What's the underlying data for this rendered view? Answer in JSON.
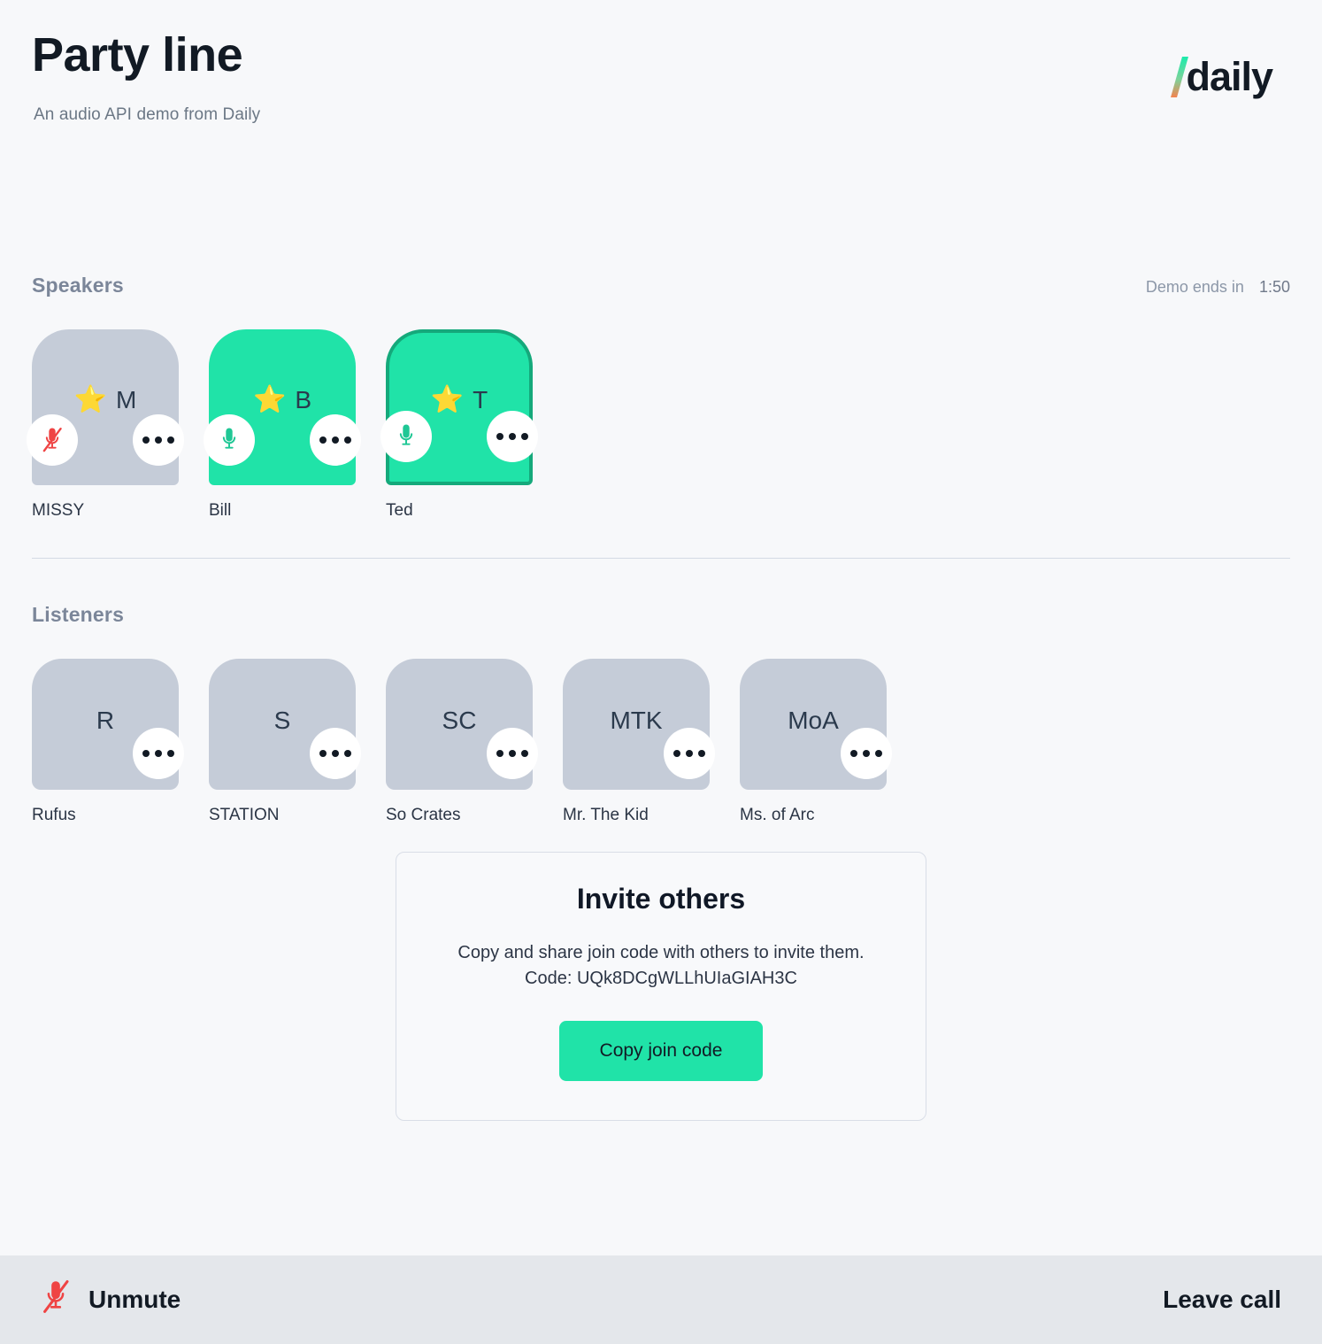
{
  "header": {
    "title": "Party line",
    "subtitle": "An audio API demo from Daily",
    "brand_name": "daily",
    "brand_slash_icon": "slash-gradient-icon",
    "brand_gradient_top": "#1bebac",
    "brand_gradient_bottom": "#f5834f"
  },
  "speakers": {
    "title": "Speakers",
    "timer_label": "Demo ends in",
    "timer_value": "1:50",
    "items": [
      {
        "initials": "M",
        "name": "MISSY",
        "star": "⭐",
        "muted": true,
        "speaking": false,
        "mic_icon": "mic-off-icon",
        "menu_icon": "more-options-icon"
      },
      {
        "initials": "B",
        "name": "Bill",
        "star": "⭐",
        "muted": false,
        "speaking": false,
        "mic_icon": "mic-on-icon",
        "menu_icon": "more-options-icon"
      },
      {
        "initials": "T",
        "name": "Ted",
        "star": "⭐",
        "muted": false,
        "speaking": true,
        "mic_icon": "mic-on-icon",
        "menu_icon": "more-options-icon"
      }
    ]
  },
  "listeners": {
    "title": "Listeners",
    "items": [
      {
        "initials": "R",
        "name": "Rufus",
        "menu_icon": "more-options-icon"
      },
      {
        "initials": "S",
        "name": "STATION",
        "menu_icon": "more-options-icon"
      },
      {
        "initials": "SC",
        "name": "So Crates",
        "menu_icon": "more-options-icon"
      },
      {
        "initials": "MTK",
        "name": "Mr. The Kid",
        "menu_icon": "more-options-icon"
      },
      {
        "initials": "MoA",
        "name": "Ms. of Arc",
        "menu_icon": "more-options-icon"
      }
    ]
  },
  "invite": {
    "title": "Invite others",
    "description": "Copy and share join code with others to invite them. Code: UQk8DCgWLLhUIaGIAH3C",
    "code": "UQk8DCgWLLhUIaGIAH3C",
    "button_label": "Copy join code"
  },
  "tray": {
    "mute_label": "Unmute",
    "mute_icon": "mic-off-icon",
    "leave_label": "Leave call"
  },
  "colors": {
    "background": "#f7f8fa",
    "tray_background": "#e4e7eb",
    "accent_green": "#20e3a8",
    "active_green_border": "#15a97b",
    "tile_gray": "#c5ccd8",
    "muted_red": "#ef4444",
    "text_dark": "#121a24",
    "text_muted": "#7b8699"
  }
}
